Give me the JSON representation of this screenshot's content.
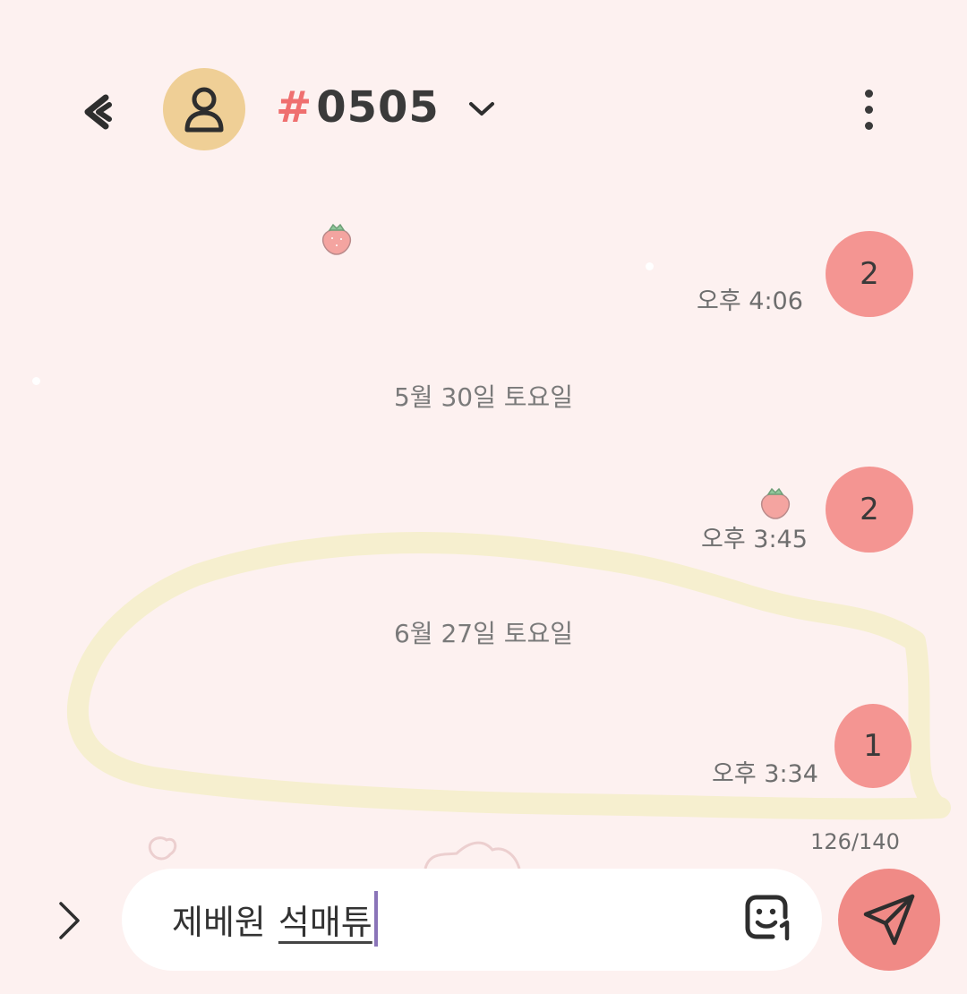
{
  "header": {
    "hash_symbol": "#",
    "title": "0505"
  },
  "messages": [
    {
      "count": "2",
      "time": "오후 4:06"
    },
    {
      "count": "2",
      "time": "오후 3:45"
    },
    {
      "count": "1",
      "time": "오후 3:34"
    }
  ],
  "date_separators": [
    "5월 30일 토요일",
    "6월 27일 토요일"
  ],
  "composer": {
    "char_counter": "126/140",
    "text_committed": "제베원",
    "text_composing": "석매튜"
  },
  "icons": {
    "back": "chevron-left-icon",
    "avatar": "person-icon",
    "dropdown": "chevron-down-icon",
    "more": "more-vertical-icon",
    "expand": "chevron-right-icon",
    "emoji": "emoji-icon",
    "send": "send-icon",
    "decoration": "strawberry-icon"
  },
  "colors": {
    "background": "#fdf1f0",
    "accent": "#f49592",
    "hash": "#ef6f6f",
    "avatar_bg": "#efcf96",
    "highlight_stroke": "#f6efcf",
    "caret": "#8a74b8"
  }
}
